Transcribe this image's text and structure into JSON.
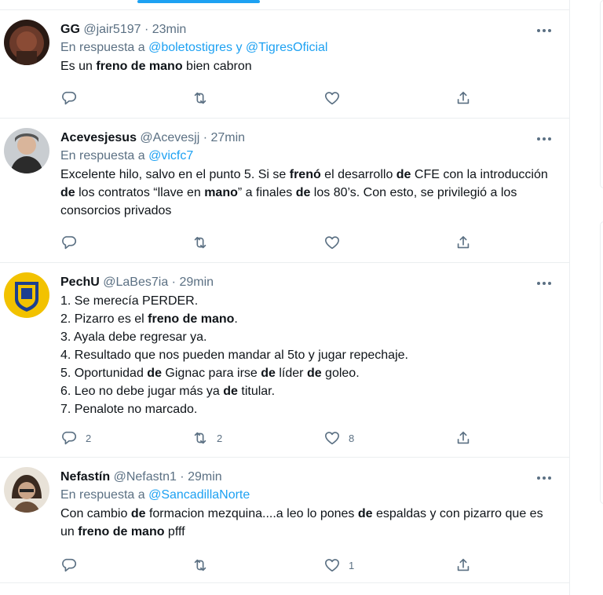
{
  "tweets": [
    {
      "name": "GG",
      "handle": "@jair5197",
      "time": "23min",
      "reply_prefix": "En respuesta a",
      "reply_to": "@boletostigres y @TigresOficial",
      "text_html": "Es un <b>freno de mano</b> bien cabron",
      "counts": {
        "reply": "",
        "retweet": "",
        "like": ""
      }
    },
    {
      "name": "Acevesjesus",
      "handle": "@Acevesjj",
      "time": "27min",
      "reply_prefix": "En respuesta a",
      "reply_to": "@vicfc7",
      "text_html": "Excelente hilo, salvo en el punto 5. Si se <b>frenó</b> el desarrollo <b>de</b> CFE con la introducción <b>de</b> los contratos “llave en <b>mano</b>” a finales <b>de</b> los 80’s. Con esto, se privilegió a los consorcios privados",
      "counts": {
        "reply": "",
        "retweet": "",
        "like": ""
      }
    },
    {
      "name": "PechU",
      "handle": "@LaBes7ia",
      "time": "29min",
      "reply_prefix": "",
      "reply_to": "",
      "text_html": "1. Se merecía PERDER.<br>2. Pizarro es el <b>freno de mano</b>.<br>3. Ayala debe regresar ya.<br>4. Resultado que nos pueden mandar al 5to y jugar repechaje.<br>5. Oportunidad <b>de</b> Gignac para irse <b>de</b> líder <b>de</b> goleo.<br>6. Leo no debe jugar más ya <b>de</b> titular.<br>7. Penalote no marcado.",
      "counts": {
        "reply": "2",
        "retweet": "2",
        "like": "8"
      }
    },
    {
      "name": "Nefastín",
      "handle": "@Nefastn1",
      "time": "29min",
      "reply_prefix": "En respuesta a",
      "reply_to": "@SancadillaNorte",
      "text_html": "Con cambio <b>de</b> formacion mezquina....a leo lo pones <b>de</b> espaldas y con pizarro que es un <b>freno de mano</b> pfff",
      "counts": {
        "reply": "",
        "retweet": "",
        "like": "1"
      }
    }
  ],
  "colors": {
    "accent": "#1da1f2",
    "secondary_text": "#5b7083",
    "border": "#ebeef0"
  },
  "icons": [
    "more-icon",
    "reply-icon",
    "retweet-icon",
    "like-icon",
    "share-icon"
  ]
}
